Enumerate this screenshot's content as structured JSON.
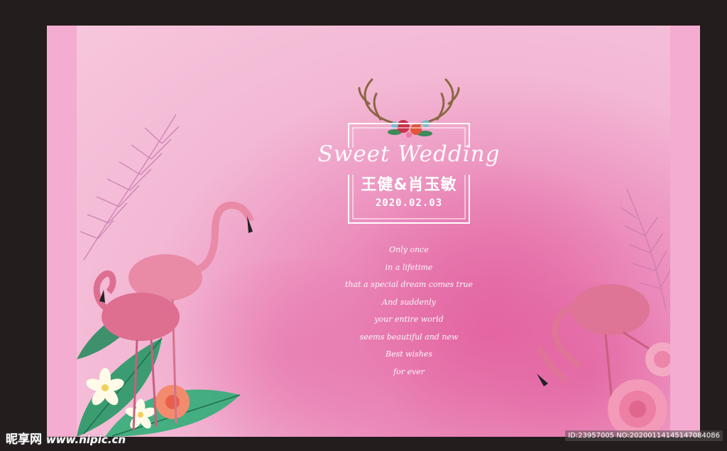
{
  "card": {
    "script_title": "Sweet Wedding",
    "names": "王健&肖玉敏",
    "date": "2020.02.03",
    "poem_lines": [
      "Only once",
      "in a lifetime",
      "that a special dream comes true",
      "And suddenly",
      "your entire world",
      "seems beautiful and new",
      "Best wishes",
      "for ever"
    ]
  },
  "watermark": {
    "brand": "昵享网",
    "url": "www.nipic.cn",
    "id_text": "ID:23957005 NO:20200114145147084086"
  },
  "colors": {
    "background": "#231d1e",
    "panel_pink": "#f4acd0",
    "canvas_pink": "#f3b8d4",
    "accent_magenta": "#e46aa4",
    "text": "#ffffff"
  },
  "icons": {
    "top_ornament": "antlers-flower-icon",
    "left_decor": "flamingo-pair-icon",
    "right_decor": "flamingo-icon"
  }
}
